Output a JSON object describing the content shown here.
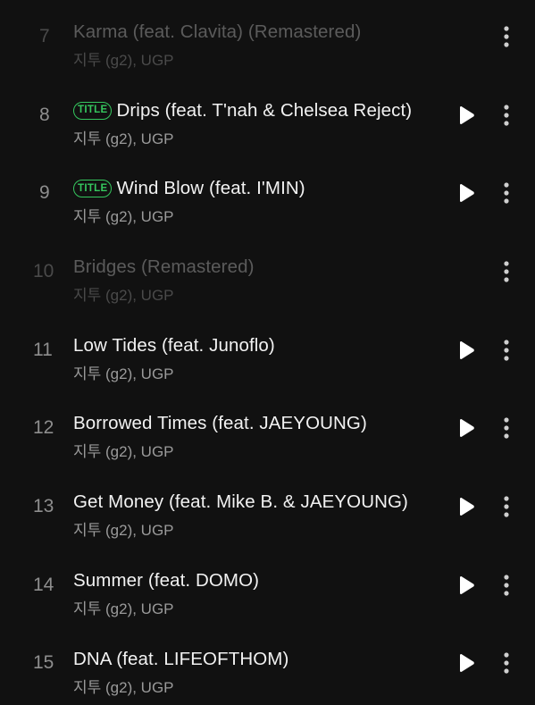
{
  "badge_label": "TITLE",
  "icons": {
    "play": "play-icon",
    "more": "more-vertical-icon"
  },
  "colors": {
    "background": "#111111",
    "title_badge": "#35c75e",
    "title_text": "#f2f2f2",
    "artist_text": "#9a9a9a",
    "disabled_text": "#5b5b5b"
  },
  "tracks": [
    {
      "number": "7",
      "title": "Karma (feat. Clavita) (Remastered)",
      "artist": "지투 (g2), UGP",
      "disabled": true,
      "title_badge": false,
      "playable": false
    },
    {
      "number": "8",
      "title": "Drips (feat. T'nah & Chelsea Reject)",
      "artist": "지투 (g2), UGP",
      "disabled": false,
      "title_badge": true,
      "playable": true
    },
    {
      "number": "9",
      "title": "Wind Blow (feat. I'MIN)",
      "artist": "지투 (g2), UGP",
      "disabled": false,
      "title_badge": true,
      "playable": true
    },
    {
      "number": "10",
      "title": "Bridges (Remastered)",
      "artist": "지투 (g2), UGP",
      "disabled": true,
      "title_badge": false,
      "playable": false
    },
    {
      "number": "11",
      "title": "Low Tides (feat. Junoflo)",
      "artist": "지투 (g2), UGP",
      "disabled": false,
      "title_badge": false,
      "playable": true
    },
    {
      "number": "12",
      "title": "Borrowed Times (feat. JAEYOUNG)",
      "artist": "지투 (g2), UGP",
      "disabled": false,
      "title_badge": false,
      "playable": true
    },
    {
      "number": "13",
      "title": "Get Money (feat. Mike B. & JAEYOUNG)",
      "artist": "지투 (g2), UGP",
      "disabled": false,
      "title_badge": false,
      "playable": true
    },
    {
      "number": "14",
      "title": "Summer (feat. DOMO)",
      "artist": "지투 (g2), UGP",
      "disabled": false,
      "title_badge": false,
      "playable": true
    },
    {
      "number": "15",
      "title": "DNA (feat. LIFEOFTHOM)",
      "artist": "지투 (g2), UGP",
      "disabled": false,
      "title_badge": false,
      "playable": true
    }
  ]
}
